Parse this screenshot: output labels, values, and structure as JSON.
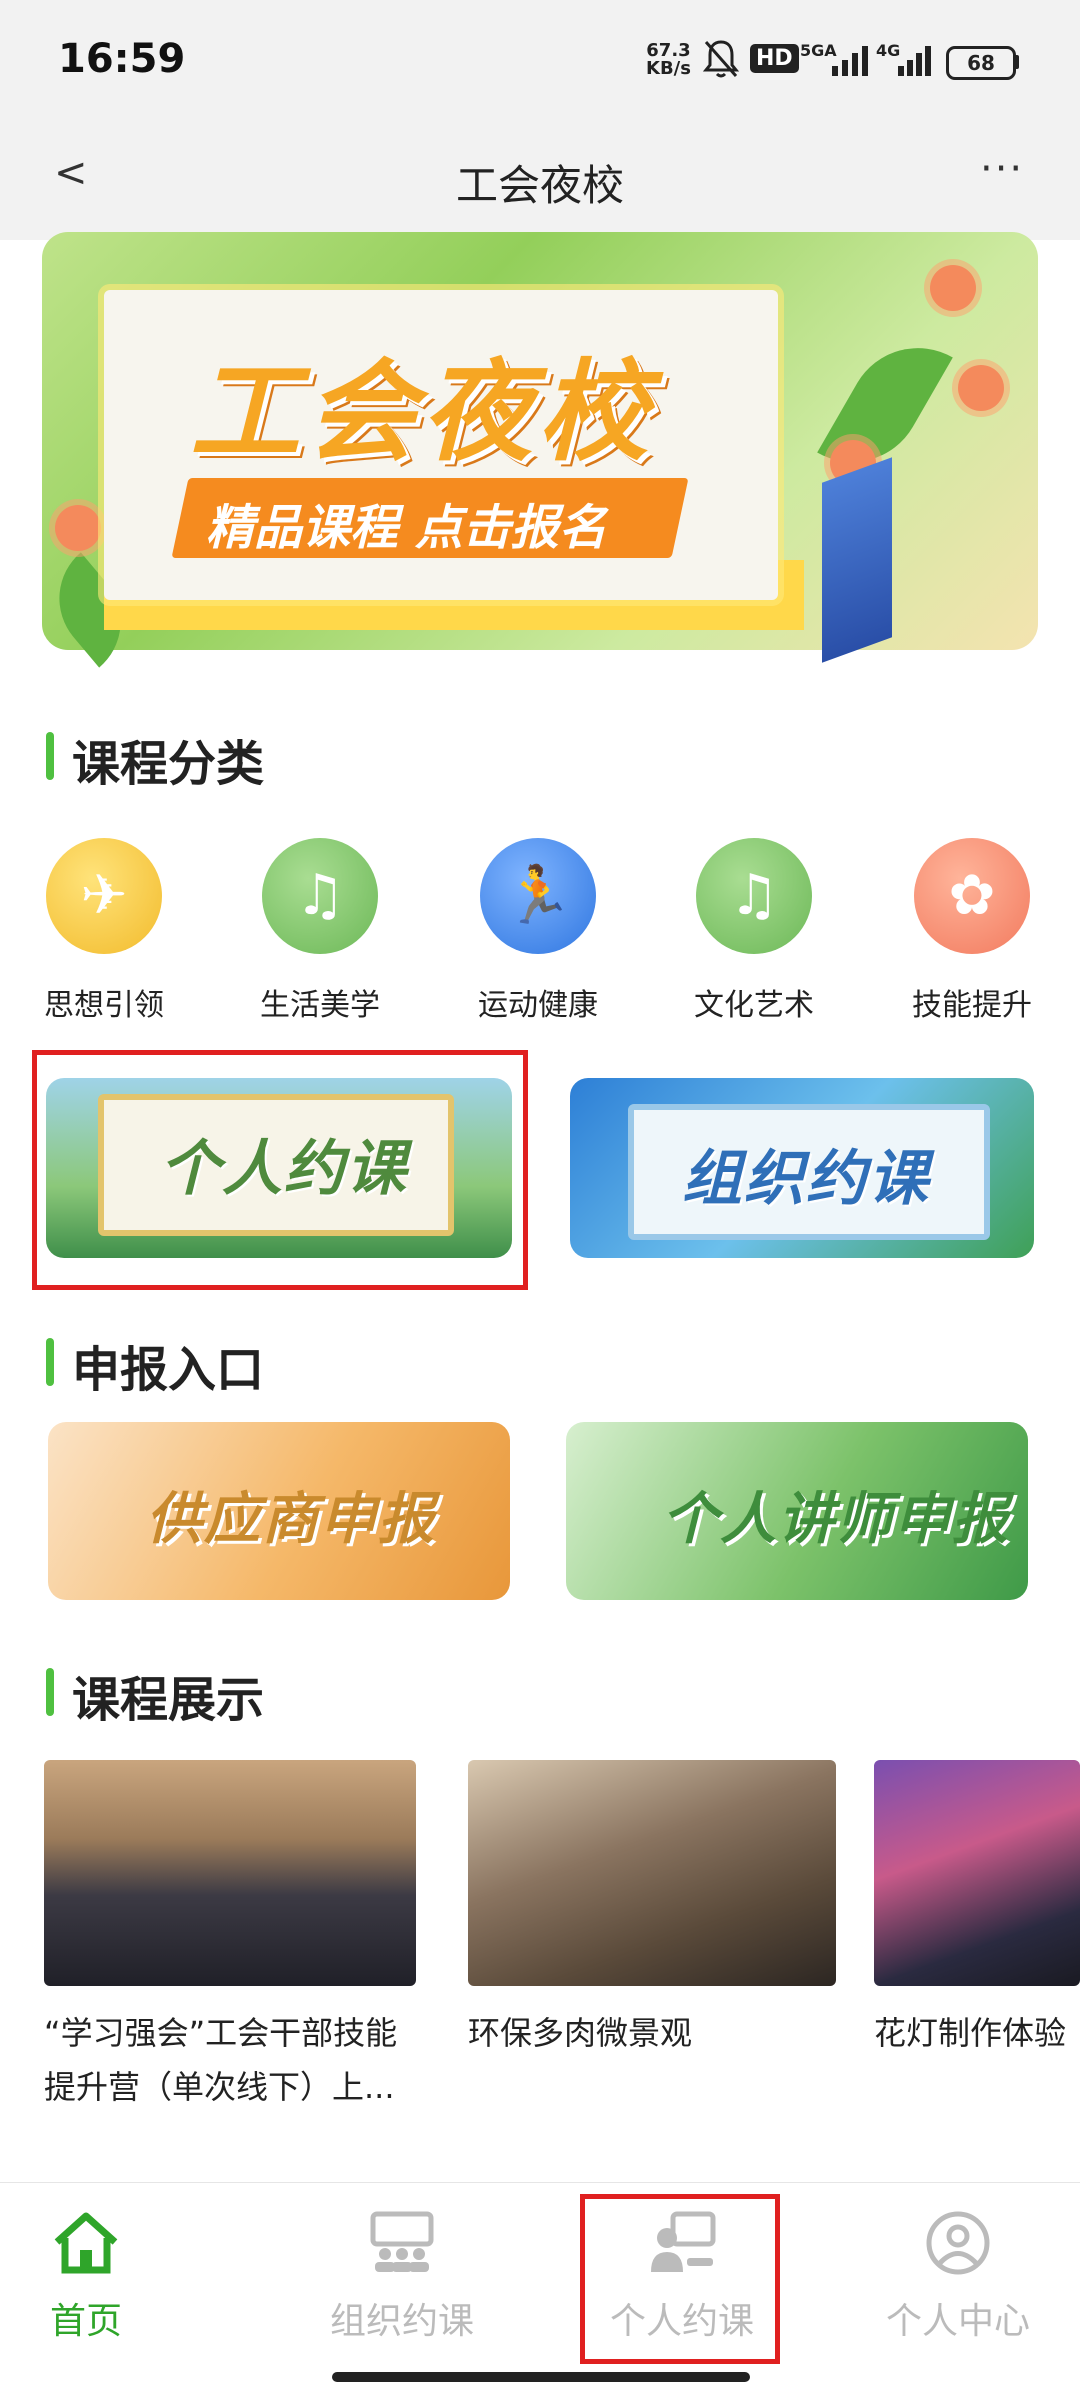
{
  "status_bar": {
    "time": "16:59",
    "net_speed_value": "67.3",
    "net_speed_unit": "KB/s",
    "hd_badge": "HD",
    "net_5g": "5GA",
    "net_4g": "4G",
    "battery": "68"
  },
  "header": {
    "back": "<",
    "title": "工会夜校",
    "more": "···"
  },
  "banner": {
    "title": "工会夜校",
    "subtitle": "精品课程  点击报名"
  },
  "sections": {
    "categories": "课程分类",
    "apply": "申报入口",
    "showcase": "课程展示"
  },
  "categories": [
    {
      "label": "思想引领",
      "color": "#f4c63f",
      "icon": "paper-plane-icon"
    },
    {
      "label": "生活美学",
      "color": "#7fc46a",
      "icon": "guitar-icon"
    },
    {
      "label": "运动健康",
      "color": "#3f86e6",
      "icon": "runner-icon"
    },
    {
      "label": "文化艺术",
      "color": "#7fc46a",
      "icon": "guitar-icon"
    },
    {
      "label": "技能提升",
      "color": "#f58c6c",
      "icon": "butterfly-icon"
    }
  ],
  "booking_cards": {
    "personal": "个人约课",
    "organization": "组织约课"
  },
  "apply_cards": {
    "supplier": "供应商申报",
    "lecturer": "个人讲师申报"
  },
  "courses": [
    {
      "title": "“学习强会”工会干部技能提升营（单次线下）上..."
    },
    {
      "title": "环保多肉微景观"
    },
    {
      "title": "花灯制作体验"
    }
  ],
  "bottom_nav": {
    "home": "首页",
    "org_booking": "组织约课",
    "personal_booking": "个人约课",
    "profile": "个人中心",
    "active_color": "#2fa52a",
    "inactive_color": "#bbbbbb"
  }
}
